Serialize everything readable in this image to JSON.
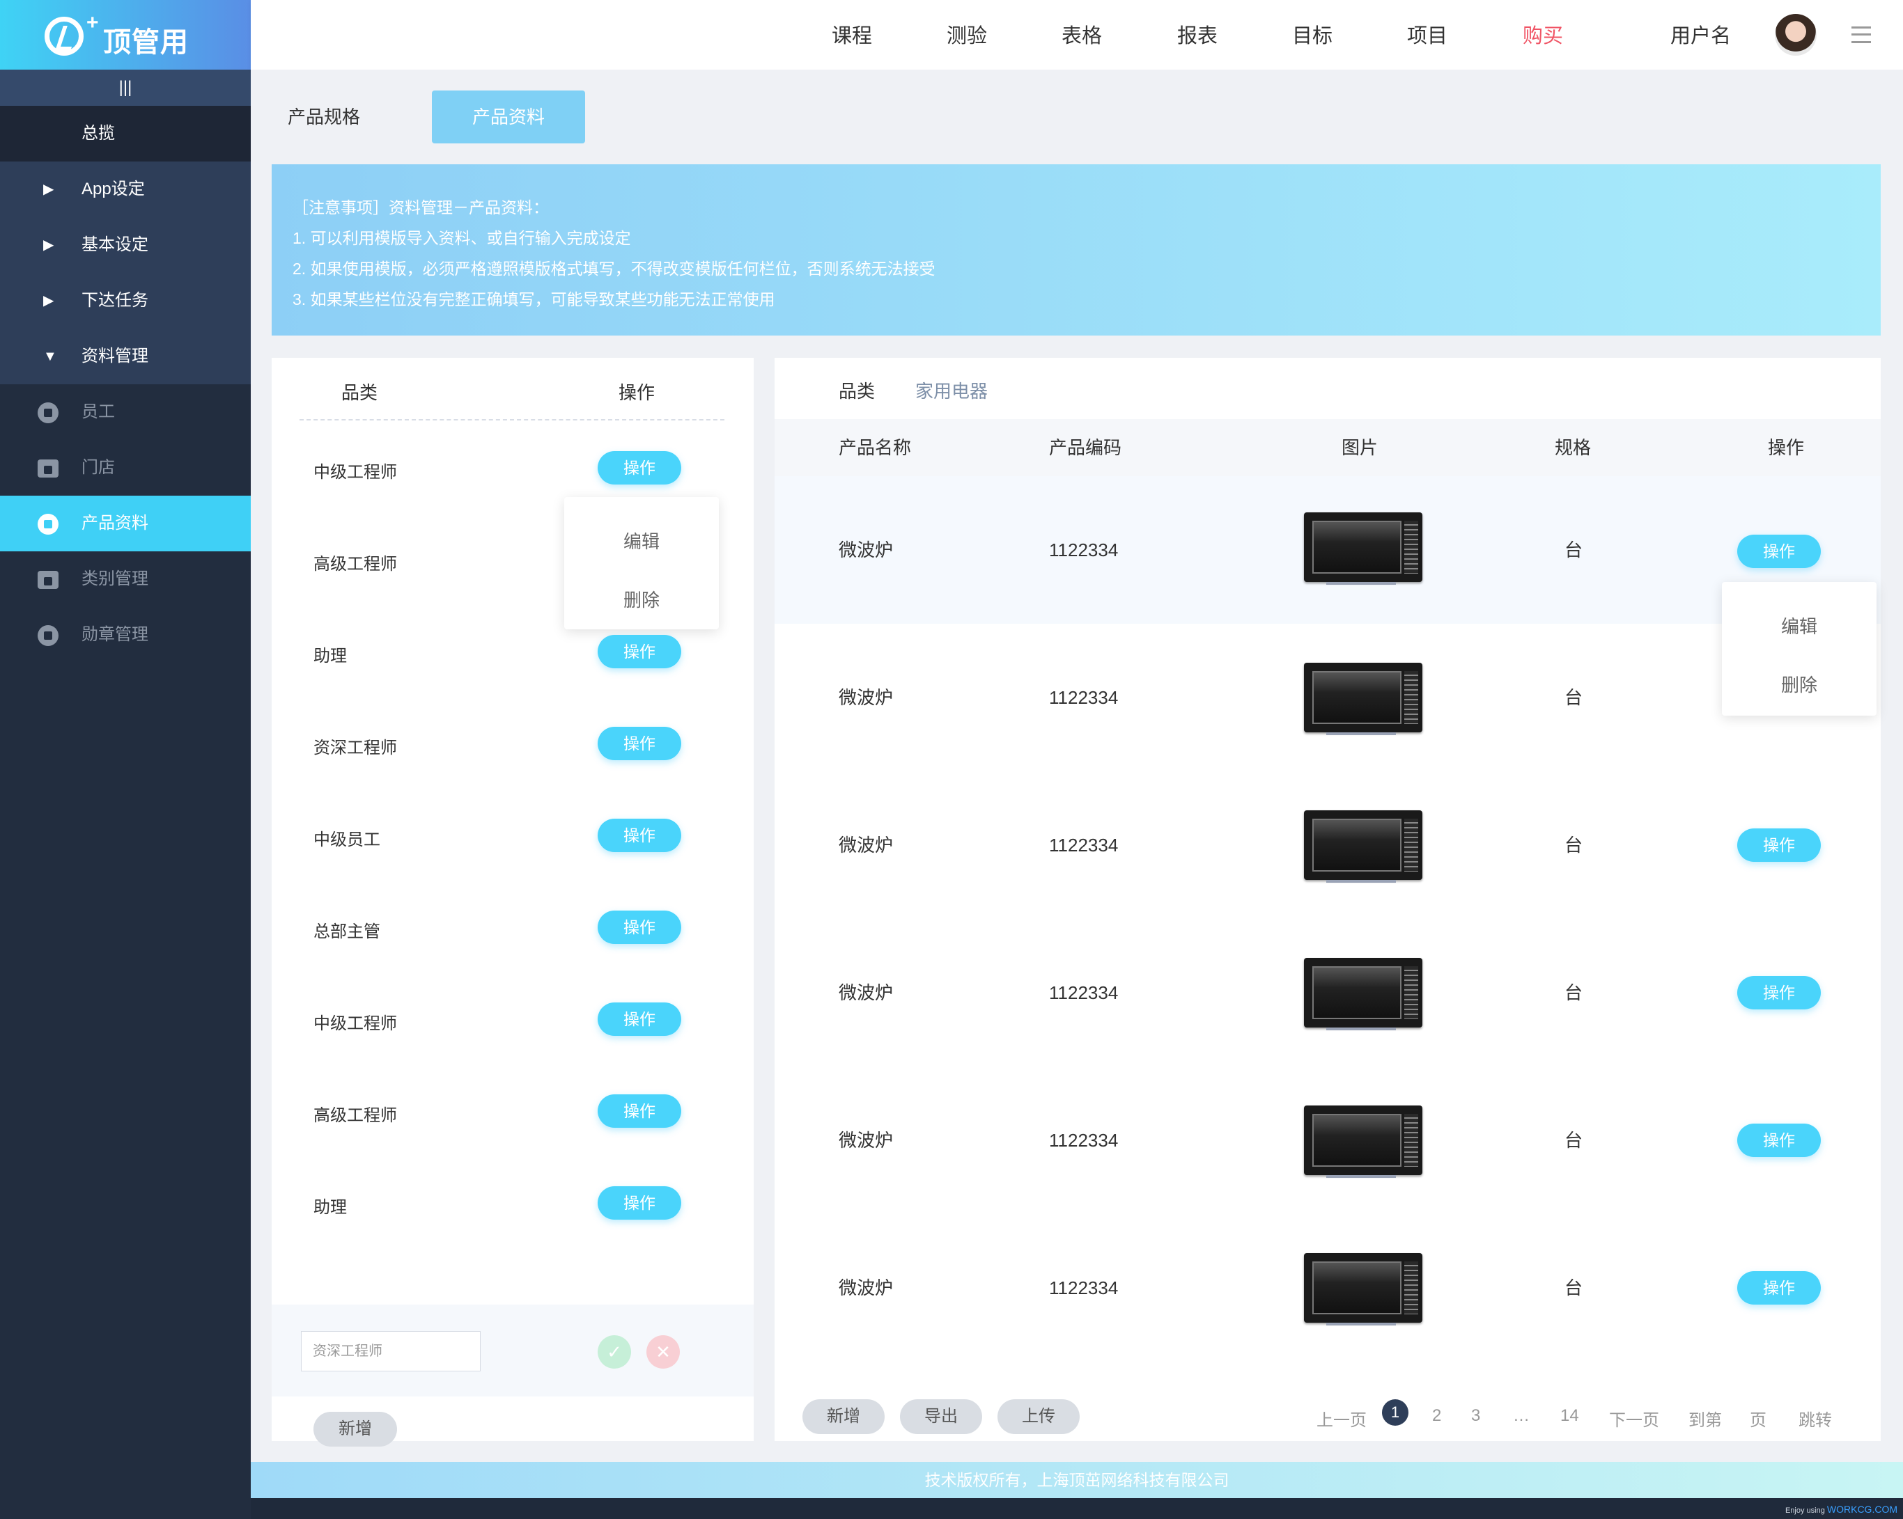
{
  "brand": {
    "logo_text": "顶管用",
    "logo_plus": "+"
  },
  "sidebar": {
    "collapse_label": "|||",
    "items": [
      {
        "label": "总揽"
      },
      {
        "label": "App设定"
      },
      {
        "label": "基本设定"
      },
      {
        "label": "下达任务"
      },
      {
        "label": "资料管理"
      },
      {
        "label": "员工"
      },
      {
        "label": "门店"
      },
      {
        "label": "产品资料"
      },
      {
        "label": "类别管理"
      },
      {
        "label": "勋章管理"
      }
    ]
  },
  "header": {
    "nav": [
      "课程",
      "测验",
      "表格",
      "报表",
      "目标",
      "项目",
      "购买"
    ],
    "user": "用户名"
  },
  "tabs": [
    "产品规格",
    "产品资料"
  ],
  "notice": {
    "lines": [
      "［注意事项］资料管理－产品资料：",
      "1. 可以利用模版导入资料、或自行输入完成设定",
      "2. 如果使用模版，必须严格遵照模版格式填写，不得改变模版任何栏位，否则系统无法接受",
      "3. 如果某些栏位没有完整正确填写，可能导致某些功能无法正常使用"
    ]
  },
  "left_panel": {
    "col_category": "品类",
    "col_action": "操作",
    "rows": [
      "中级工程师",
      "高级工程师",
      "助理",
      "资深工程师",
      "中级员工",
      "总部主管",
      "中级工程师",
      "高级工程师",
      "助理"
    ],
    "action_label": "操作",
    "popup": {
      "edit": "编辑",
      "delete": "删除"
    },
    "edit_input_value": "资深工程师",
    "ok_icon": "✓",
    "cancel_icon": "✕",
    "add_label": "新增"
  },
  "right_panel": {
    "category_label": "品类",
    "category_value": "家用电器",
    "columns": [
      "产品名称",
      "产品编码",
      "图片",
      "规格",
      "操作"
    ],
    "rows": [
      {
        "name": "微波炉",
        "code": "1122334",
        "unit": "台"
      },
      {
        "name": "微波炉",
        "code": "1122334",
        "unit": "台"
      },
      {
        "name": "微波炉",
        "code": "1122334",
        "unit": "台"
      },
      {
        "name": "微波炉",
        "code": "1122334",
        "unit": "台"
      },
      {
        "name": "微波炉",
        "code": "1122334",
        "unit": "台"
      },
      {
        "name": "微波炉",
        "code": "1122334",
        "unit": "台"
      }
    ],
    "action_label": "操作",
    "popup": {
      "edit": "编辑",
      "delete": "删除"
    },
    "buttons": {
      "add": "新增",
      "export": "导出",
      "upload": "上传"
    },
    "pager": {
      "prev": "上一页",
      "pages": [
        "1",
        "2",
        "3",
        "…",
        "14"
      ],
      "next": "下一页",
      "goto": "到第",
      "page": "页",
      "jump": "跳转"
    }
  },
  "footer": {
    "copyright": "技术版权所有，上海顶茁网络科技有限公司"
  },
  "credit": {
    "text": "Enjoy using",
    "site": "WORKCG.COM"
  },
  "colors": {
    "accent": "#4ad4fb",
    "sidebar": "#222d3f",
    "buy": "#f05465"
  }
}
